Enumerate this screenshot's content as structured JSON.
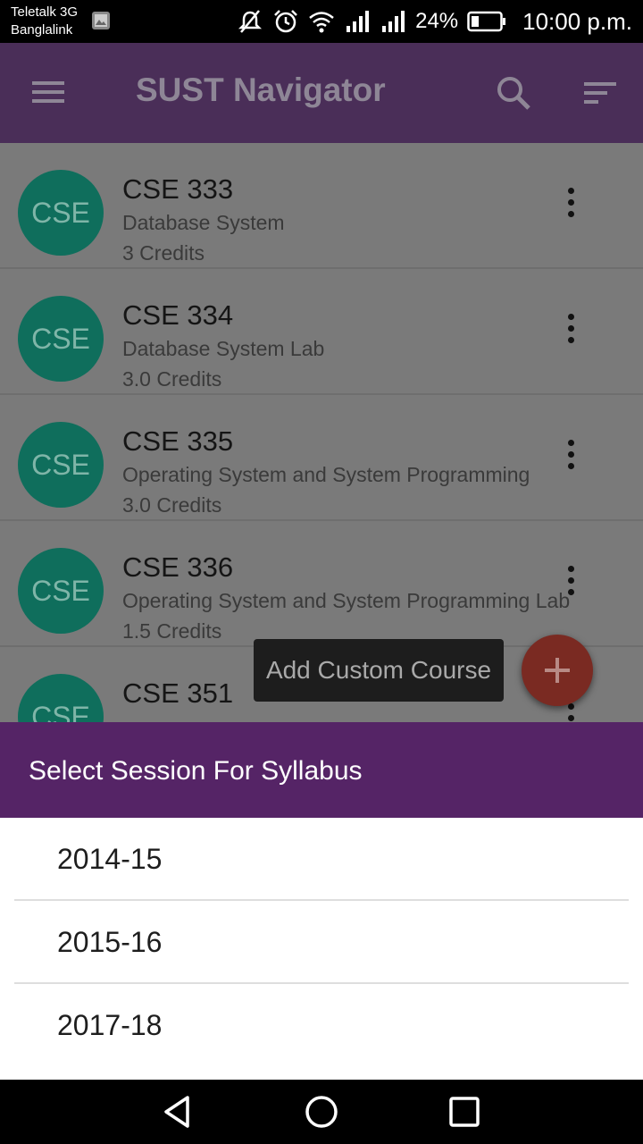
{
  "status_bar": {
    "carrier_line1": "Teletalk 3G",
    "carrier_line2": "Banglalink",
    "battery": "24%",
    "time": "10:00 p.m.",
    "icons": [
      "image-icon",
      "mute-icon",
      "alarm-icon",
      "wifi-icon",
      "signal-icon",
      "signal-icon",
      "battery-icon"
    ]
  },
  "app_bar": {
    "title": "SUST Navigator",
    "color": "#4a2e58",
    "icons": [
      "menu-icon",
      "search-icon",
      "sort-icon"
    ]
  },
  "courses": [
    {
      "badge": "CSE",
      "code": "CSE 333",
      "name": "Database System",
      "credits": "3 Credits"
    },
    {
      "badge": "CSE",
      "code": "CSE 334",
      "name": "Database System Lab",
      "credits": "3.0 Credits"
    },
    {
      "badge": "CSE",
      "code": "CSE 335",
      "name": "Operating System and System Programming",
      "credits": "3.0 Credits"
    },
    {
      "badge": "CSE",
      "code": "CSE 336",
      "name": "Operating System and System Programming Lab",
      "credits": "1.5 Credits"
    },
    {
      "badge": "CSE",
      "code": "CSE 351",
      "name": "",
      "credits": ""
    }
  ],
  "fab": {
    "tooltip": "Add Custom Course",
    "icon": "plus-icon",
    "color": "#c0392b"
  },
  "dialog": {
    "title": "Select Session For Syllabus",
    "header_color": "#552466",
    "options": [
      "2014-15",
      "2015-16",
      "2017-18"
    ]
  },
  "nav_bar": {
    "icons": [
      "back-icon",
      "home-icon",
      "recents-icon"
    ]
  }
}
